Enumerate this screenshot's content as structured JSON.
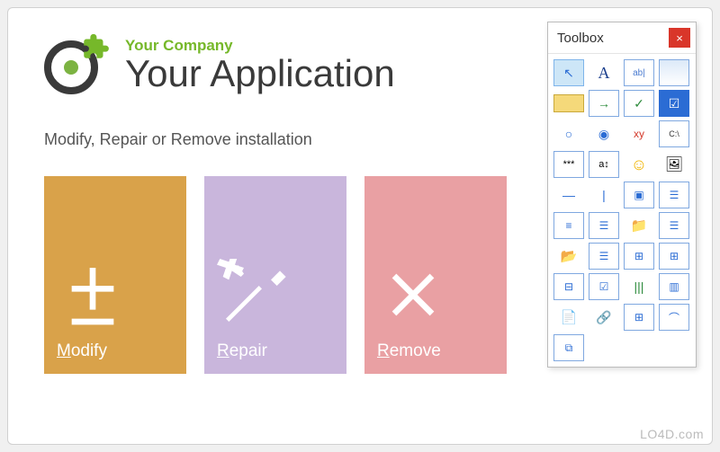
{
  "header": {
    "company": "Your Company",
    "appname": "Your Application"
  },
  "subtitle": "Modify, Repair or Remove installation",
  "tiles": {
    "modify": {
      "label": "Modify",
      "accel": "M",
      "color": "#d9a24a"
    },
    "repair": {
      "label": "Repair",
      "accel": "R",
      "color": "#c9b6dc"
    },
    "remove": {
      "label": "Remove",
      "accel": "R",
      "color": "#e9a0a3"
    }
  },
  "toolbox": {
    "title": "Toolbox",
    "close": "×",
    "tools": [
      {
        "name": "pointer-icon",
        "glyph": "↖",
        "selected": true
      },
      {
        "name": "text-label-icon",
        "glyph": "A"
      },
      {
        "name": "textbox-icon",
        "glyph": "ab|"
      },
      {
        "name": "panel-icon",
        "glyph": "▭"
      },
      {
        "name": "button-icon",
        "glyph": "▬"
      },
      {
        "name": "link-icon",
        "glyph": "→"
      },
      {
        "name": "checkbox-icon",
        "glyph": "✓"
      },
      {
        "name": "checkbox-checked-icon",
        "glyph": "☑"
      },
      {
        "name": "radio-outline-icon",
        "glyph": "○"
      },
      {
        "name": "radio-filled-icon",
        "glyph": "◉"
      },
      {
        "name": "xy-label-icon",
        "glyph": "xy"
      },
      {
        "name": "path-box-icon",
        "glyph": "C:\\"
      },
      {
        "name": "password-icon",
        "glyph": "***"
      },
      {
        "name": "font-picker-icon",
        "glyph": "a↕"
      },
      {
        "name": "smiley-icon",
        "glyph": "☺"
      },
      {
        "name": "image-icon",
        "glyph": "🖼"
      },
      {
        "name": "hrule-icon",
        "glyph": "—"
      },
      {
        "name": "vrule-icon",
        "glyph": "|"
      },
      {
        "name": "groupbox-icon",
        "glyph": "▣"
      },
      {
        "name": "listview-icon",
        "glyph": "☰"
      },
      {
        "name": "list-icon",
        "glyph": "≡"
      },
      {
        "name": "detail-list-icon",
        "glyph": "☰"
      },
      {
        "name": "folder-icon",
        "glyph": "📁"
      },
      {
        "name": "detail-list2-icon",
        "glyph": "☰"
      },
      {
        "name": "folder-down-icon",
        "glyph": "📂"
      },
      {
        "name": "db-list-icon",
        "glyph": "☰"
      },
      {
        "name": "tree-icon",
        "glyph": "⊞"
      },
      {
        "name": "tree-check-icon",
        "glyph": "⊞"
      },
      {
        "name": "tree-nodes-icon",
        "glyph": "⊟"
      },
      {
        "name": "checklist-icon",
        "glyph": "☑"
      },
      {
        "name": "bars-icon",
        "glyph": "|||"
      },
      {
        "name": "columns-icon",
        "glyph": "▥"
      },
      {
        "name": "note-icon",
        "glyph": "📄"
      },
      {
        "name": "chain-icon",
        "glyph": "🔗"
      },
      {
        "name": "grid-icon",
        "glyph": "⊞"
      },
      {
        "name": "tab-icon",
        "glyph": "⌒"
      },
      {
        "name": "copy-icon",
        "glyph": "⧉"
      }
    ]
  },
  "watermark": "LO4D.com"
}
